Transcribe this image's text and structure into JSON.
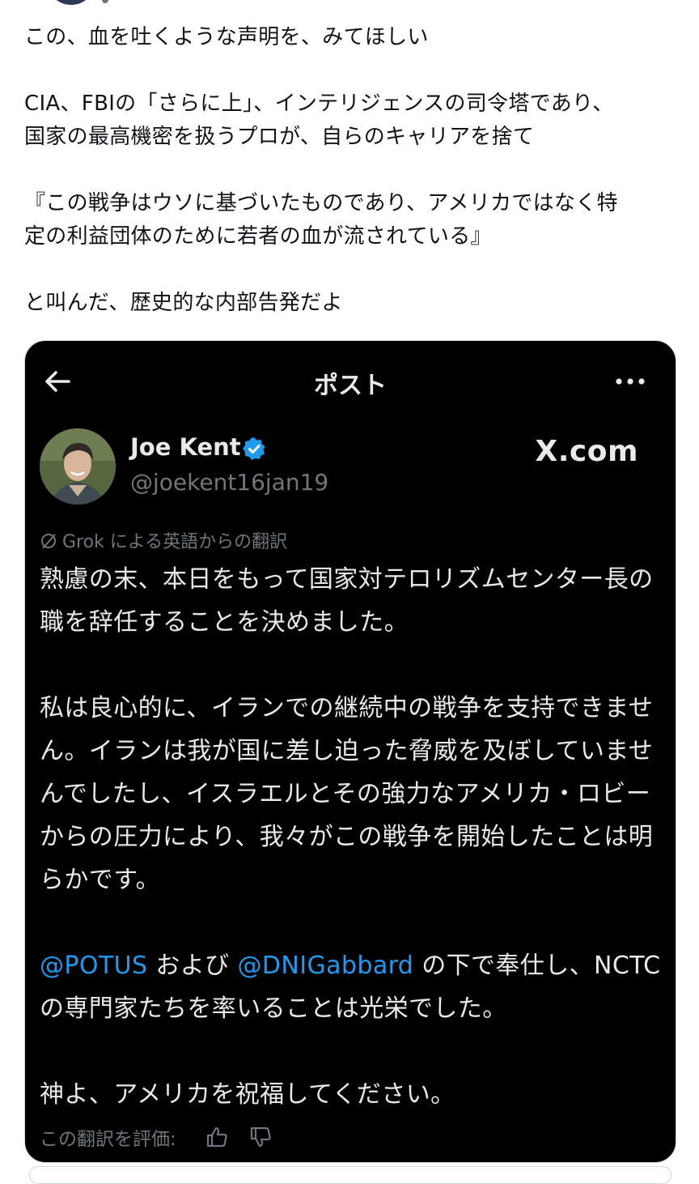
{
  "tweet": {
    "paragraphs": [
      "この、血を吐くような声明を、みてほしい",
      "CIA、FBIの「さらに上」、インテリジェンスの司令塔であり、\n国家の最高機密を扱うプロが、自らのキャリアを捨て",
      "『この戦争はウソに基づいたものであり、アメリカではなく特\n定の利益団体のために若者の血が流されている』",
      "と叫んだ、歴史的な内部告発だよ"
    ]
  },
  "quoted_screenshot": {
    "header_title": "ポスト",
    "author": {
      "name": "Joe Kent",
      "handle": "@joekent16jan19",
      "verified": true
    },
    "site_label": "X.com",
    "translation_note": "Grok による英語からの翻訳",
    "body": {
      "p1": "熟慮の末、本日をもって国家対テロリズムセンター長の職を辞任することを決めました。",
      "p2": "私は良心的に、イランでの継続中の戦争を支持できません。イランは我が国に差し迫った脅威を及ぼしていませんでしたし、イスラエルとその強力なアメリカ・ロビーからの圧力により、我々がこの戦争を開始したことは明らかです。",
      "p3_mention1": "@POTUS",
      "p3_text1": " および ",
      "p3_mention2": "@DNIGabbard",
      "p3_text2": " の下で奉仕し、NCTC の専門家たちを率いることは光栄でした。",
      "p4": "神よ、アメリカを祝福してください。"
    },
    "rate_label": "この翻訳を評価:",
    "colors": {
      "background": "#000000",
      "text": "#e7e9ea",
      "muted": "#71767b",
      "link": "#1d9bf0",
      "verified": "#1d9bf0"
    }
  }
}
